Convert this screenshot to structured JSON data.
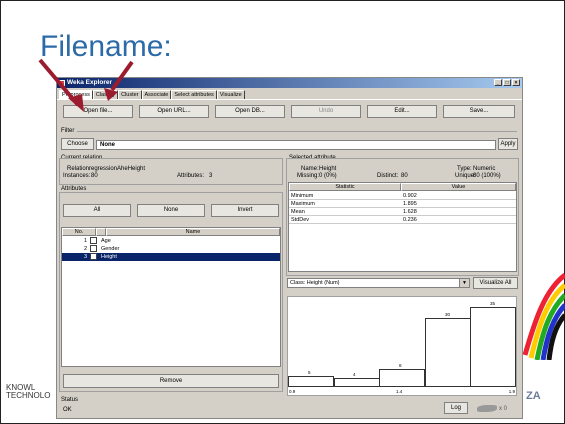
{
  "slide": {
    "title": "Filename:",
    "logo_left": [
      "KNOWL",
      "TECHNOLO"
    ],
    "logo_right": "ZA"
  },
  "window": {
    "title": "Weka Explorer",
    "controls": [
      "_",
      "□",
      "×"
    ]
  },
  "tabs": [
    "Preprocess",
    "Classify",
    "Cluster",
    "Associate",
    "Select attributes",
    "Visualize"
  ],
  "toolbar": {
    "open_file": "Open file...",
    "open_url": "Open URL...",
    "open_db": "Open DB...",
    "undo": "Undo",
    "edit": "Edit...",
    "save": "Save..."
  },
  "filter": {
    "label": "Filter",
    "choose": "Choose",
    "value": "None",
    "apply": "Apply"
  },
  "current_relation": {
    "header": "Current relation",
    "relation_label": "Relation:",
    "relation_value": "regressionAheHeight",
    "instances_label": "Instances:",
    "instances_value": "80",
    "attributes_label": "Attributes:",
    "attributes_value": "3"
  },
  "attributes": {
    "header": "Attributes",
    "all": "All",
    "none": "None",
    "invert": "Invert",
    "col_no": "No.",
    "col_name": "Name",
    "rows": [
      {
        "no": "1",
        "name": "Age",
        "selected": false
      },
      {
        "no": "2",
        "name": "Gender",
        "selected": false
      },
      {
        "no": "3",
        "name": "Height",
        "selected": true
      }
    ],
    "remove": "Remove"
  },
  "selected_attribute": {
    "header": "Selected attribute",
    "name_label": "Name:",
    "name_value": "Height",
    "type_label": "Type:",
    "type_value": "Numeric",
    "missing_label": "Missing:",
    "missing_value": "0 (0%)",
    "distinct_label": "Distinct:",
    "distinct_value": "80",
    "unique_label": "Unique:",
    "unique_value": "80 (100%)",
    "col_statistic": "Statistic",
    "col_value": "Value",
    "stats": [
      {
        "name": "Minimum",
        "value": "0.902"
      },
      {
        "name": "Maximum",
        "value": "1.895"
      },
      {
        "name": "Mean",
        "value": "1.628"
      },
      {
        "name": "StdDev",
        "value": "0.236"
      }
    ]
  },
  "class_select": {
    "value": "Class: Height (Num)",
    "visualize_all": "Visualize All"
  },
  "histogram": {
    "bin_counts": [
      5,
      4,
      8,
      30,
      35
    ],
    "axis_labels": [
      "0.9",
      "1.4",
      "1.9"
    ]
  },
  "status": {
    "header": "Status",
    "text": "OK",
    "log": "Log",
    "count": "x 0"
  }
}
